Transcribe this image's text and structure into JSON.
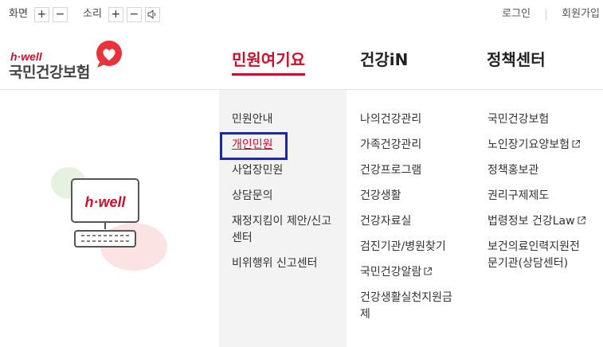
{
  "utility": {
    "screen_label": "화면",
    "sound_label": "소리",
    "plus": "+",
    "minus": "−",
    "login": "로그인",
    "signup": "회원가입"
  },
  "logo": {
    "sub": "h·well",
    "main": "국민건강보험"
  },
  "gnb": [
    {
      "label": "민원여기요",
      "active": true
    },
    {
      "label": "건강iN",
      "active": false
    },
    {
      "label": "정책센터",
      "active": false
    }
  ],
  "menu": {
    "col1": [
      "민원안내",
      "개인민원",
      "사업장민원",
      "상담문의",
      "재정지킴이 제안/신고센터",
      "비위행위 신고센터"
    ],
    "col1_line_a": "재정지킴이 제안/신고",
    "col1_line_b": "센터",
    "col2": [
      "나의건강관리",
      "가족건강관리",
      "건강프로그램",
      "건강생활",
      "건강자료실",
      "검진기관/병원찾기",
      "국민건강알람",
      "건강생활실천지원금제"
    ],
    "col2_line_a": "건강생활실천지원금",
    "col2_line_b": "제",
    "col3": [
      "국민건강보험",
      "노인장기요양보험",
      "정책홍보관",
      "권리구제제도",
      "법령정보 건강Law",
      "보건의료인력지원전문기관(상담센터)"
    ],
    "col3_line_a": "보건의료인력지원전",
    "col3_line_b": "문기관(상담센터)"
  },
  "illustration": {
    "screen_text": "h·well"
  },
  "colors": {
    "accent": "#c8102e",
    "focus": "#1a2e8c",
    "panel_bg": "#f3f3f3"
  }
}
